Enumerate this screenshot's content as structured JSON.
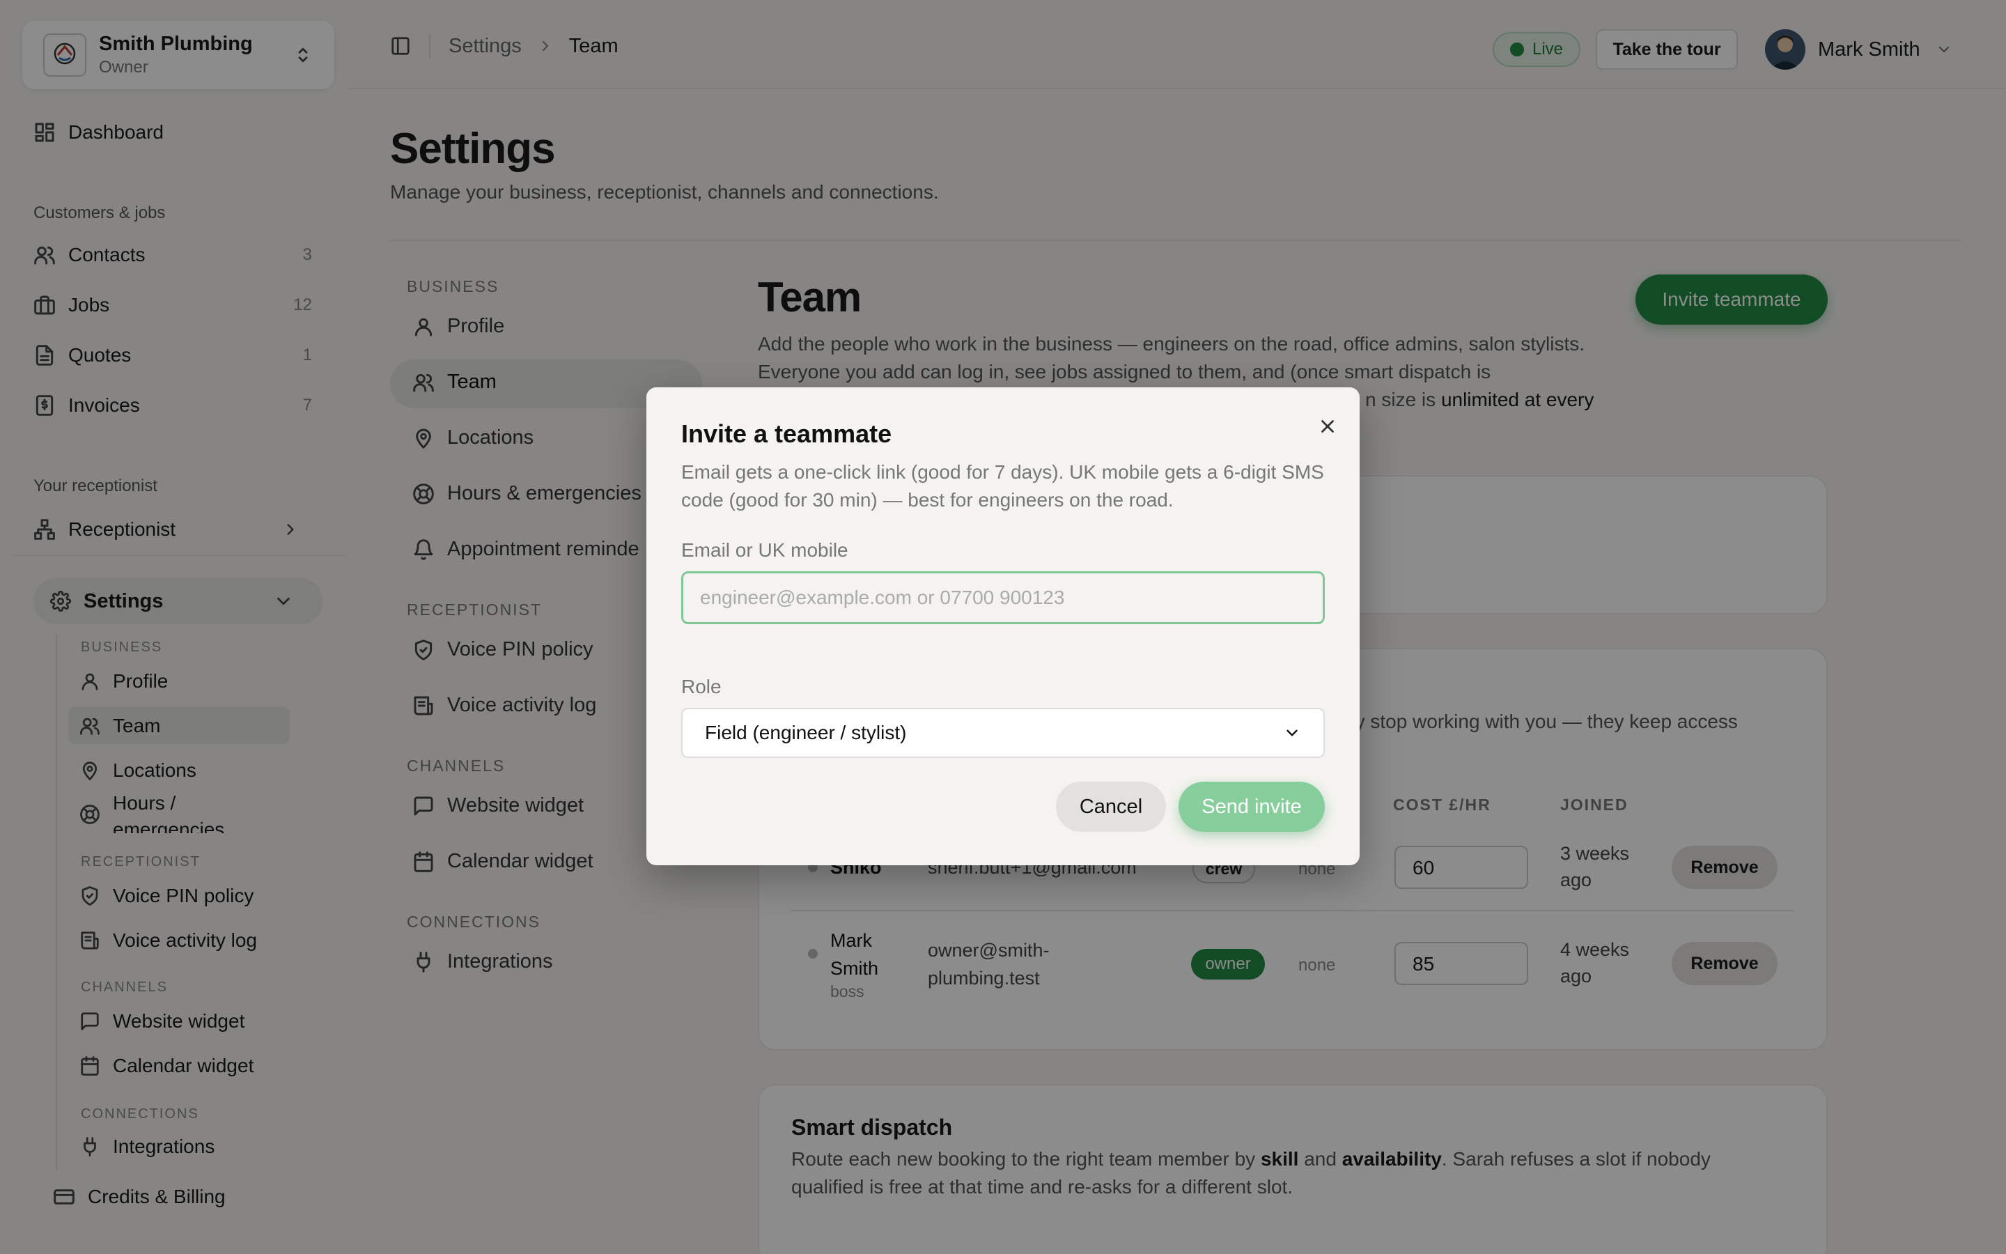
{
  "business": {
    "name": "Smith Plumbing",
    "role": "Owner"
  },
  "sidebar": {
    "dashboard": "Dashboard",
    "customers_heading": "Customers & jobs",
    "items": [
      {
        "label": "Contacts",
        "count": "3",
        "icon": "users-icon"
      },
      {
        "label": "Jobs",
        "count": "12",
        "icon": "briefcase-icon"
      },
      {
        "label": "Quotes",
        "count": "1",
        "icon": "document-icon"
      },
      {
        "label": "Invoices",
        "count": "7",
        "icon": "invoice-icon"
      }
    ],
    "receptionist_heading": "Your receptionist",
    "receptionist": "Receptionist",
    "settings": "Settings",
    "sub": {
      "business_h": "BUSINESS",
      "profile": "Profile",
      "team": "Team",
      "locations": "Locations",
      "hours": "Hours / emergencies",
      "receptionist_h": "RECEPTIONIST",
      "voice_pin": "Voice PIN policy",
      "voice_log": "Voice activity log",
      "channels_h": "CHANNELS",
      "website": "Website widget",
      "calendar": "Calendar widget",
      "connections_h": "CONNECTIONS",
      "integrations": "Integrations"
    },
    "credits": "Credits & Billing"
  },
  "topbar": {
    "crumb1": "Settings",
    "crumb2": "Team",
    "live": "Live",
    "tour": "Take the tour",
    "user": "Mark Smith"
  },
  "page": {
    "title": "Settings",
    "subtitle": "Manage your business, receptionist, channels and connections."
  },
  "settings_nav": {
    "business_h": "BUSINESS",
    "profile": "Profile",
    "team": "Team",
    "locations": "Locations",
    "hours": "Hours & emergencies",
    "reminders": "Appointment reminde",
    "receptionist_h": "RECEPTIONIST",
    "voice_pin": "Voice PIN policy",
    "voice_log": "Voice activity log",
    "channels_h": "CHANNELS",
    "website": "Website widget",
    "calendar": "Calendar widget",
    "connections_h": "CONNECTIONS",
    "integrations": "Integrations"
  },
  "team": {
    "title": "Team",
    "desc1": "Add the people who work in the business — engineers on the road, office admins, salon stylists. Everyone you add can log in, see jobs assigned to them, and (once smart dispatch is",
    "desc2": "n size is",
    "desc_bold": "unlimited at every",
    "invite_button": "Invite teammate",
    "card2_text": "ey stop working with you — they keep access",
    "columns": {
      "cost": "COST £/HR",
      "joined": "JOINED"
    },
    "rows": [
      {
        "name": "Shiko",
        "email": "sherif.butt+1@gmail.com",
        "role": "crew",
        "skills": "none",
        "cost": "60",
        "joined": "3 weeks ago",
        "action": "Remove"
      },
      {
        "name": "Mark Smith",
        "title": "boss",
        "email": "owner@smith-plumbing.test",
        "role": "owner",
        "skills": "none",
        "cost": "85",
        "joined": "4 weeks ago",
        "action": "Remove"
      }
    ]
  },
  "smart_dispatch": {
    "title": "Smart dispatch",
    "p1": "Route each new booking to the right team member by",
    "skill": "skill",
    "and": "and",
    "availability": "availability",
    "p2": ". Sarah refuses a slot if nobody qualified is free at that time and re-asks for a different slot."
  },
  "modal": {
    "title": "Invite a teammate",
    "desc": "Email gets a one-click link (good for 7 days). UK mobile gets a 6-digit SMS code (good for 30 min) — best for engineers on the road.",
    "contact_label": "Email or UK mobile",
    "contact_placeholder": "engineer@example.com or 07700 900123",
    "role_label": "Role",
    "role_value": "Field (engineer / stylist)",
    "cancel": "Cancel",
    "send": "Send invite"
  },
  "colors": {
    "accent": "#1f8a43",
    "accent_light": "#86cf9c",
    "background": "#f4f3ef"
  }
}
